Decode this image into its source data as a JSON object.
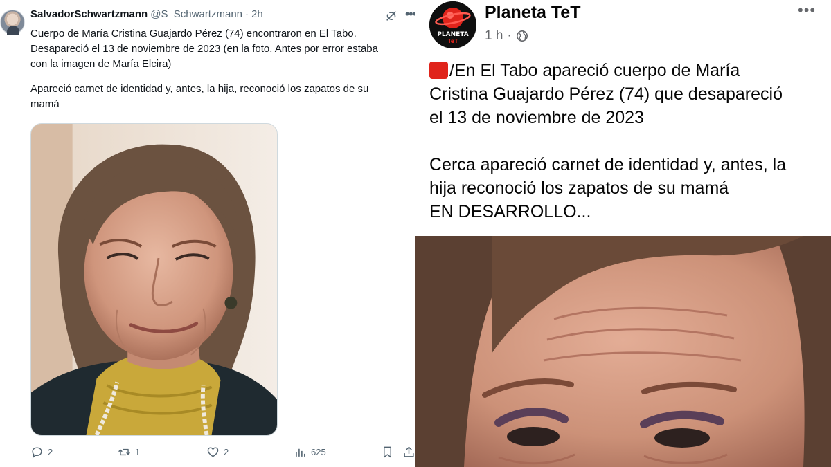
{
  "tweet": {
    "display_name": "SalvadorSchwartzmann",
    "handle": "@S_Schwartzmann",
    "separator": "·",
    "time": "2h",
    "more": "•••",
    "paragraph_1": "Cuerpo de María Cristina Guajardo Pérez (74) encontraron en El Tabo.\nDesapareció el 13 de noviembre de 2023 (en la foto. Antes por error estaba\ncon la imagen de María Elcira)",
    "paragraph_2": "Apareció carnet de identidad y, antes, la hija, reconoció los zapatos de su\nmamá",
    "actions": {
      "replies": "2",
      "reposts": "1",
      "likes": "2",
      "views": "625"
    },
    "icons": [
      "grok-icon",
      "reply-icon",
      "repost-icon",
      "like-icon",
      "views-icon",
      "bookmark-icon",
      "share-icon"
    ]
  },
  "facebook": {
    "page_name": "Planeta TeT",
    "logo_text_top": "PLANETA",
    "logo_text_bottom": "TeT",
    "time": "1 h",
    "separator": "·",
    "more": "•••",
    "red_square_icon": "red-square-icon",
    "paragraph_1": "/En El Tabo apareció cuerpo de María\nCristina Guajardo Pérez (74) que desapareció\nel 13 de noviembre de 2023",
    "paragraph_2": "Cerca apareció carnet de identidad y, antes, la\nhija reconoció los zapatos de su mamá\nEN DESARROLLO...",
    "colors": {
      "red_square": "#e0241b",
      "logo_ring": "#e0241b"
    }
  }
}
